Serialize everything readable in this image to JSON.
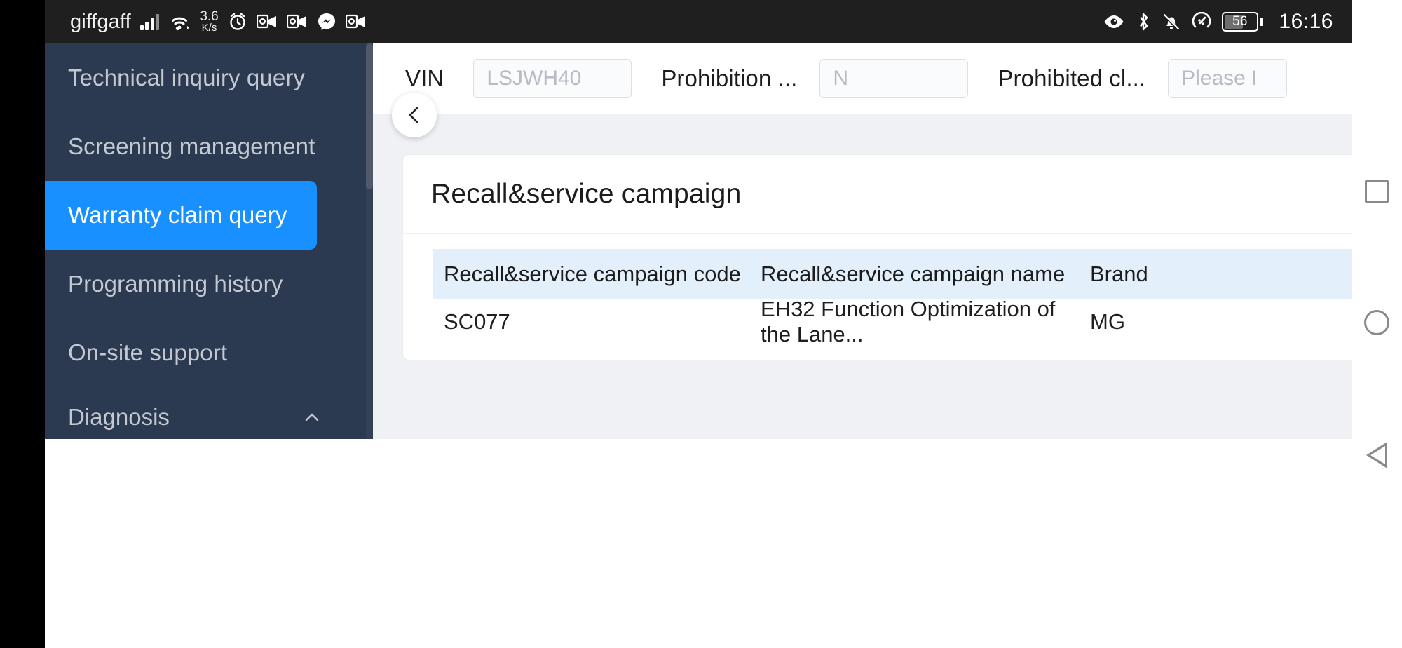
{
  "status_bar": {
    "carrier": "giffgaff",
    "network_speed_value": "3.6",
    "network_speed_unit": "K/s",
    "time": "16:16",
    "battery_level": "56",
    "left_icons": [
      "signal-bars-icon",
      "wifi-icon",
      "alarm-clock-icon",
      "outlook-icon",
      "outlook-icon",
      "messenger-icon",
      "outlook-icon"
    ],
    "right_icons": [
      "eye-icon",
      "bluetooth-icon",
      "bell-off-icon",
      "data-saver-icon",
      "battery-icon"
    ]
  },
  "sidebar": {
    "items": [
      {
        "label": "Technical inquiry query",
        "active": false
      },
      {
        "label": "Screening management",
        "active": false
      },
      {
        "label": "Warranty claim query",
        "active": true
      },
      {
        "label": "Programming history",
        "active": false
      },
      {
        "label": "On-site support",
        "active": false
      }
    ],
    "group": {
      "label": "Diagnosis",
      "expanded": true
    },
    "collapse_button": "collapse-sidebar",
    "active_color": "#1890ff",
    "background_color": "#2b3a51"
  },
  "filter_bar": {
    "fields": [
      {
        "label": "VIN",
        "placeholder": "LSJWH40",
        "value": ""
      },
      {
        "label": "Prohibition ...",
        "placeholder": "N",
        "value": ""
      },
      {
        "label": "Prohibited cl...",
        "placeholder": "Please I",
        "value": ""
      }
    ]
  },
  "card": {
    "title": "Recall&service campaign",
    "table": {
      "columns": [
        "Recall&service campaign code",
        "Recall&service campaign name",
        "Brand"
      ],
      "rows": [
        {
          "code": "SC077",
          "name": "EH32 Function Optimization of the Lane...",
          "brand": "MG"
        }
      ],
      "header_background": "#e3effb"
    }
  },
  "system_nav": {
    "recents": "recents-square-icon",
    "home": "home-circle-icon",
    "back": "back-triangle-icon"
  }
}
